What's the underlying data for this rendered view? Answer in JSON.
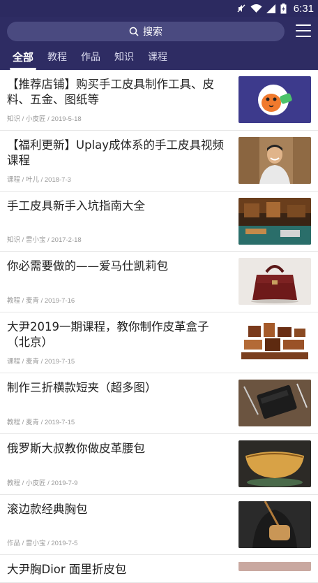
{
  "status_bar": {
    "time": "6:31"
  },
  "search": {
    "placeholder": "搜索"
  },
  "tabs": [
    "全部",
    "教程",
    "作品",
    "知识",
    "课程"
  ],
  "articles": [
    {
      "title": "【推荐店铺】购买手工皮具制作工具、皮料、五金、图纸等",
      "category": "知识",
      "author": "小皮匠",
      "date": "2019-5-18",
      "thumb": "shop-mascot"
    },
    {
      "title": "【福利更新】Uplay成体系的手工皮具视频课程",
      "category": "课程",
      "author": "叶儿",
      "date": "2018-7-3",
      "thumb": "instructor-portrait"
    },
    {
      "title": "手工皮具新手入坑指南大全",
      "category": "知识",
      "author": "雷小宝",
      "date": "2017-2-18",
      "thumb": "workshop"
    },
    {
      "title": "你必需要做的——爱马仕凯莉包",
      "category": "教程",
      "author": "麦青",
      "date": "2019-7-16",
      "thumb": "kelly-bag"
    },
    {
      "title": "大尹2019一期课程，教你制作皮革盒子（北京）",
      "category": "课程",
      "author": "麦青",
      "date": "2019-7-15",
      "thumb": "leather-boxes"
    },
    {
      "title": "制作三折横款短夹（超多图）",
      "category": "教程",
      "author": "麦青",
      "date": "2019-7-15",
      "thumb": "wallet"
    },
    {
      "title": "俄罗斯大叔教你做皮革腰包",
      "category": "教程",
      "author": "小皮匠",
      "date": "2019-7-9",
      "thumb": "waist-bag"
    },
    {
      "title": "滚边款经典胸包",
      "category": "作品",
      "author": "雷小宝",
      "date": "2019-7-5",
      "thumb": "chest-bag"
    },
    {
      "title": "大尹胸Dior 面里折皮包",
      "category": "",
      "author": "",
      "date": "",
      "thumb": "partial"
    }
  ]
}
